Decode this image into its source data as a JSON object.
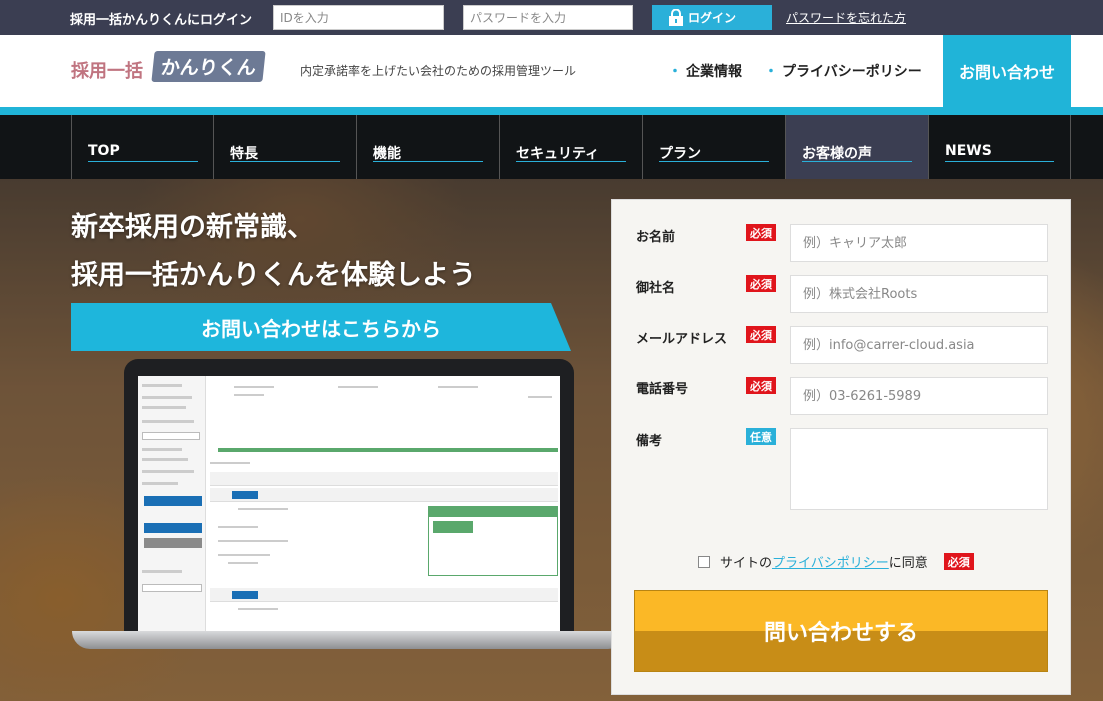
{
  "topbar": {
    "title": "採用一括かんりくんにログイン",
    "id_placeholder": "IDを入力",
    "password_placeholder": "パスワードを入力",
    "login_label": "ログイン",
    "forgot_label": "パスワードを忘れた方"
  },
  "header": {
    "logo_text_a": "採用一括",
    "logo_text_b": "かんりくん",
    "tagline": "内定承諾率を上げたい会社のための採用管理ツール",
    "links": [
      "企業情報",
      "プライバシーポリシー"
    ],
    "contact_label": "お問い合わせ"
  },
  "nav": {
    "items": [
      "TOP",
      "特長",
      "機能",
      "セキュリティ",
      "プラン",
      "お客様の声",
      "NEWS"
    ],
    "active_index": 5
  },
  "hero": {
    "headline_line1": "新卒採用の新常識、",
    "headline_line2": "採用一括かんりくんを体験しよう",
    "cta_label": "お問い合わせはこちらから"
  },
  "form": {
    "fields": [
      {
        "label": "お名前",
        "badge": "必須",
        "placeholder": "例）キャリア太郎"
      },
      {
        "label": "御社名",
        "badge": "必須",
        "placeholder": "例）株式会社Roots"
      },
      {
        "label": "メールアドレス",
        "badge": "必須",
        "placeholder": "例）info@carrer-cloud.asia"
      },
      {
        "label": "電話番号",
        "badge": "必須",
        "placeholder": "例）03-6261-5989"
      },
      {
        "label": "備考",
        "badge": "任意",
        "placeholder": ""
      }
    ],
    "agree_prefix": "サイトの",
    "agree_link": "プライバシポリシー",
    "agree_suffix": "に同意",
    "agree_badge": "必須",
    "submit_label": "問い合わせする"
  },
  "colors": {
    "accent": "#20b4d8",
    "dark_bar": "#3b3e52",
    "nav_bg": "#111416",
    "required": "#e0151c",
    "submit": "#fbb826"
  }
}
